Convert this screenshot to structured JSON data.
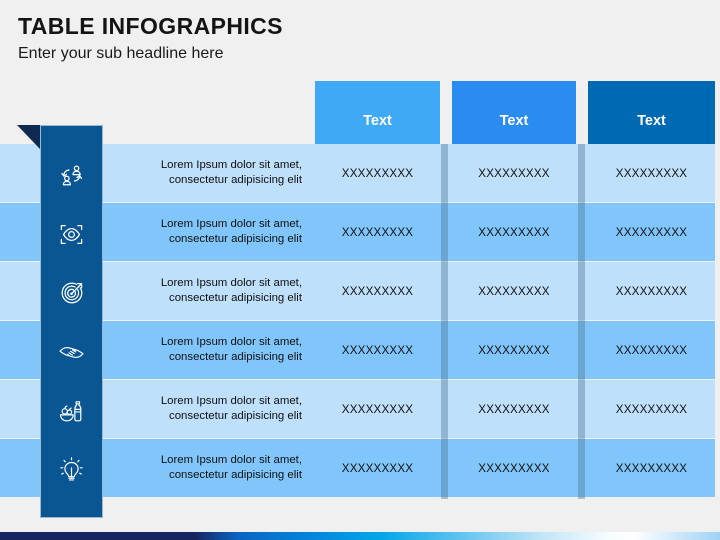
{
  "header": {
    "title": "TABLE INFOGRAPHICS",
    "subtitle": "Enter your sub headline here"
  },
  "colors": {
    "background": "#f0f0f0",
    "sidebar": "#0a5693",
    "fold": "#10294f",
    "row_light": "#bfe0fb",
    "row_dark": "#80c6fb",
    "column_1": "#3fa9f5",
    "column_2": "#2a8cf0",
    "column_3": "#0069b4",
    "divider": "rgba(72,110,140,0.38)",
    "title_text": "#141414",
    "header_text": "#ffffff"
  },
  "table": {
    "columns": [
      {
        "label": "Text",
        "color": "#3fa9f5"
      },
      {
        "label": "Text",
        "color": "#2a8cf0"
      },
      {
        "label": "Text",
        "color": "#0069b4"
      }
    ],
    "rows": [
      {
        "icon": "people-exchange-icon",
        "desc_line1": "Lorem Ipsum dolor sit amet,",
        "desc_line2": "consectetur adipisicing elit",
        "cells": [
          "XXXXXXXXX",
          "XXXXXXXXX",
          "XXXXXXXXX"
        ]
      },
      {
        "icon": "eye-focus-icon",
        "desc_line1": "Lorem Ipsum dolor sit amet,",
        "desc_line2": "consectetur adipisicing elit",
        "cells": [
          "XXXXXXXXX",
          "XXXXXXXXX",
          "XXXXXXXXX"
        ]
      },
      {
        "icon": "target-arrow-icon",
        "desc_line1": "Lorem Ipsum dolor sit amet,",
        "desc_line2": "consectetur adipisicing elit",
        "cells": [
          "XXXXXXXXX",
          "XXXXXXXXX",
          "XXXXXXXXX"
        ]
      },
      {
        "icon": "handshake-icon",
        "desc_line1": "Lorem Ipsum dolor sit amet,",
        "desc_line2": "consectetur adipisicing elit",
        "cells": [
          "XXXXXXXXX",
          "XXXXXXXXX",
          "XXXXXXXXX"
        ]
      },
      {
        "icon": "healthy-food-bottle-icon",
        "desc_line1": "Lorem Ipsum dolor sit amet,",
        "desc_line2": "consectetur adipisicing elit",
        "cells": [
          "XXXXXXXXX",
          "XXXXXXXXX",
          "XXXXXXXXX"
        ]
      },
      {
        "icon": "lightbulb-icon",
        "desc_line1": "Lorem Ipsum dolor sit amet,",
        "desc_line2": "consectetur adipisicing elit",
        "cells": [
          "XXXXXXXXX",
          "XXXXXXXXX",
          "XXXXXXXXX"
        ]
      }
    ]
  }
}
